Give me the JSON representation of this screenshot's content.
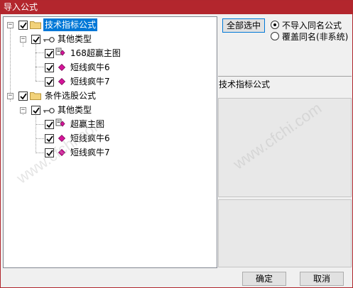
{
  "window": {
    "title": "导入公式"
  },
  "tree": {
    "groups": [
      {
        "label": "技术指标公式",
        "sub_label": "其他类型",
        "items": [
          "168超赢主图",
          "短线疯牛6",
          "短线疯牛7"
        ]
      },
      {
        "label": "条件选股公式",
        "sub_label": "其他类型",
        "items": [
          "超赢主图",
          "短线疯牛6",
          "短线疯牛7"
        ]
      }
    ]
  },
  "right": {
    "select_all_label": "全部选中",
    "radio_options": [
      "不导入同名公式",
      "覆盖同名(非系统)"
    ],
    "radio_selected_index": 0,
    "section_label": "技术指标公式"
  },
  "footer": {
    "ok_label": "确定",
    "cancel_label": "取消"
  },
  "watermark_text": "www.cfchi.com",
  "colors": {
    "titlebar": "#b3262d",
    "selection": "#0078d7",
    "diamond": "#d6149a"
  }
}
